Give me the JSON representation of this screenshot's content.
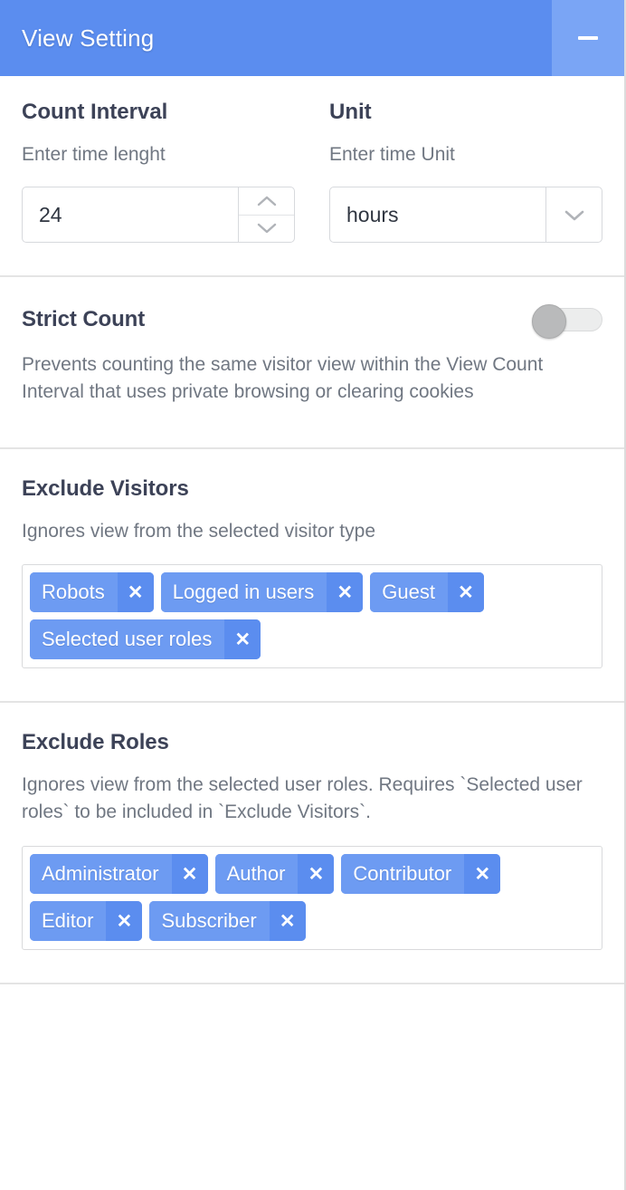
{
  "window": {
    "title": "View Setting",
    "minimize_label": "–",
    "header_color": "#5b8def",
    "minimize_bg": "#7aa5f5"
  },
  "count_interval": {
    "label": "Count Interval",
    "sub_label": "Enter time lenght",
    "value": "24",
    "stepper_up_icon": "chevron-up-icon",
    "stepper_down_icon": "chevron-down-icon"
  },
  "unit": {
    "label": "Unit",
    "sub_label": "Enter time Unit",
    "value": "hours",
    "dropdown_icon": "chevron-down-icon"
  },
  "strict_count": {
    "title": "Strict Count",
    "description": "Prevents counting the same visitor view within the View Count Interval that uses private browsing or clearing cookies",
    "toggle_state": "off"
  },
  "exclude_visitors": {
    "title": "Exclude Visitors",
    "description": "Ignores view from the selected visitor type",
    "remove_icon": "close-icon",
    "tags": [
      {
        "label": "Robots"
      },
      {
        "label": "Logged in users"
      },
      {
        "label": "Guest"
      },
      {
        "label": "Selected user roles"
      }
    ]
  },
  "exclude_roles": {
    "title": "Exclude Roles",
    "description": "Ignores view from the selected user roles. Requires `Selected user roles` to be included in `Exclude Visitors`.",
    "remove_icon": "close-icon",
    "tags": [
      {
        "label": "Administrator"
      },
      {
        "label": "Author"
      },
      {
        "label": "Contributor"
      },
      {
        "label": "Editor"
      },
      {
        "label": "Subscriber"
      }
    ]
  },
  "tag_remove_glyph": "✕",
  "colors": {
    "accent": "#5b8def",
    "tag_body": "#6d9bf2",
    "heading": "#3c4257",
    "muted": "#707782"
  }
}
